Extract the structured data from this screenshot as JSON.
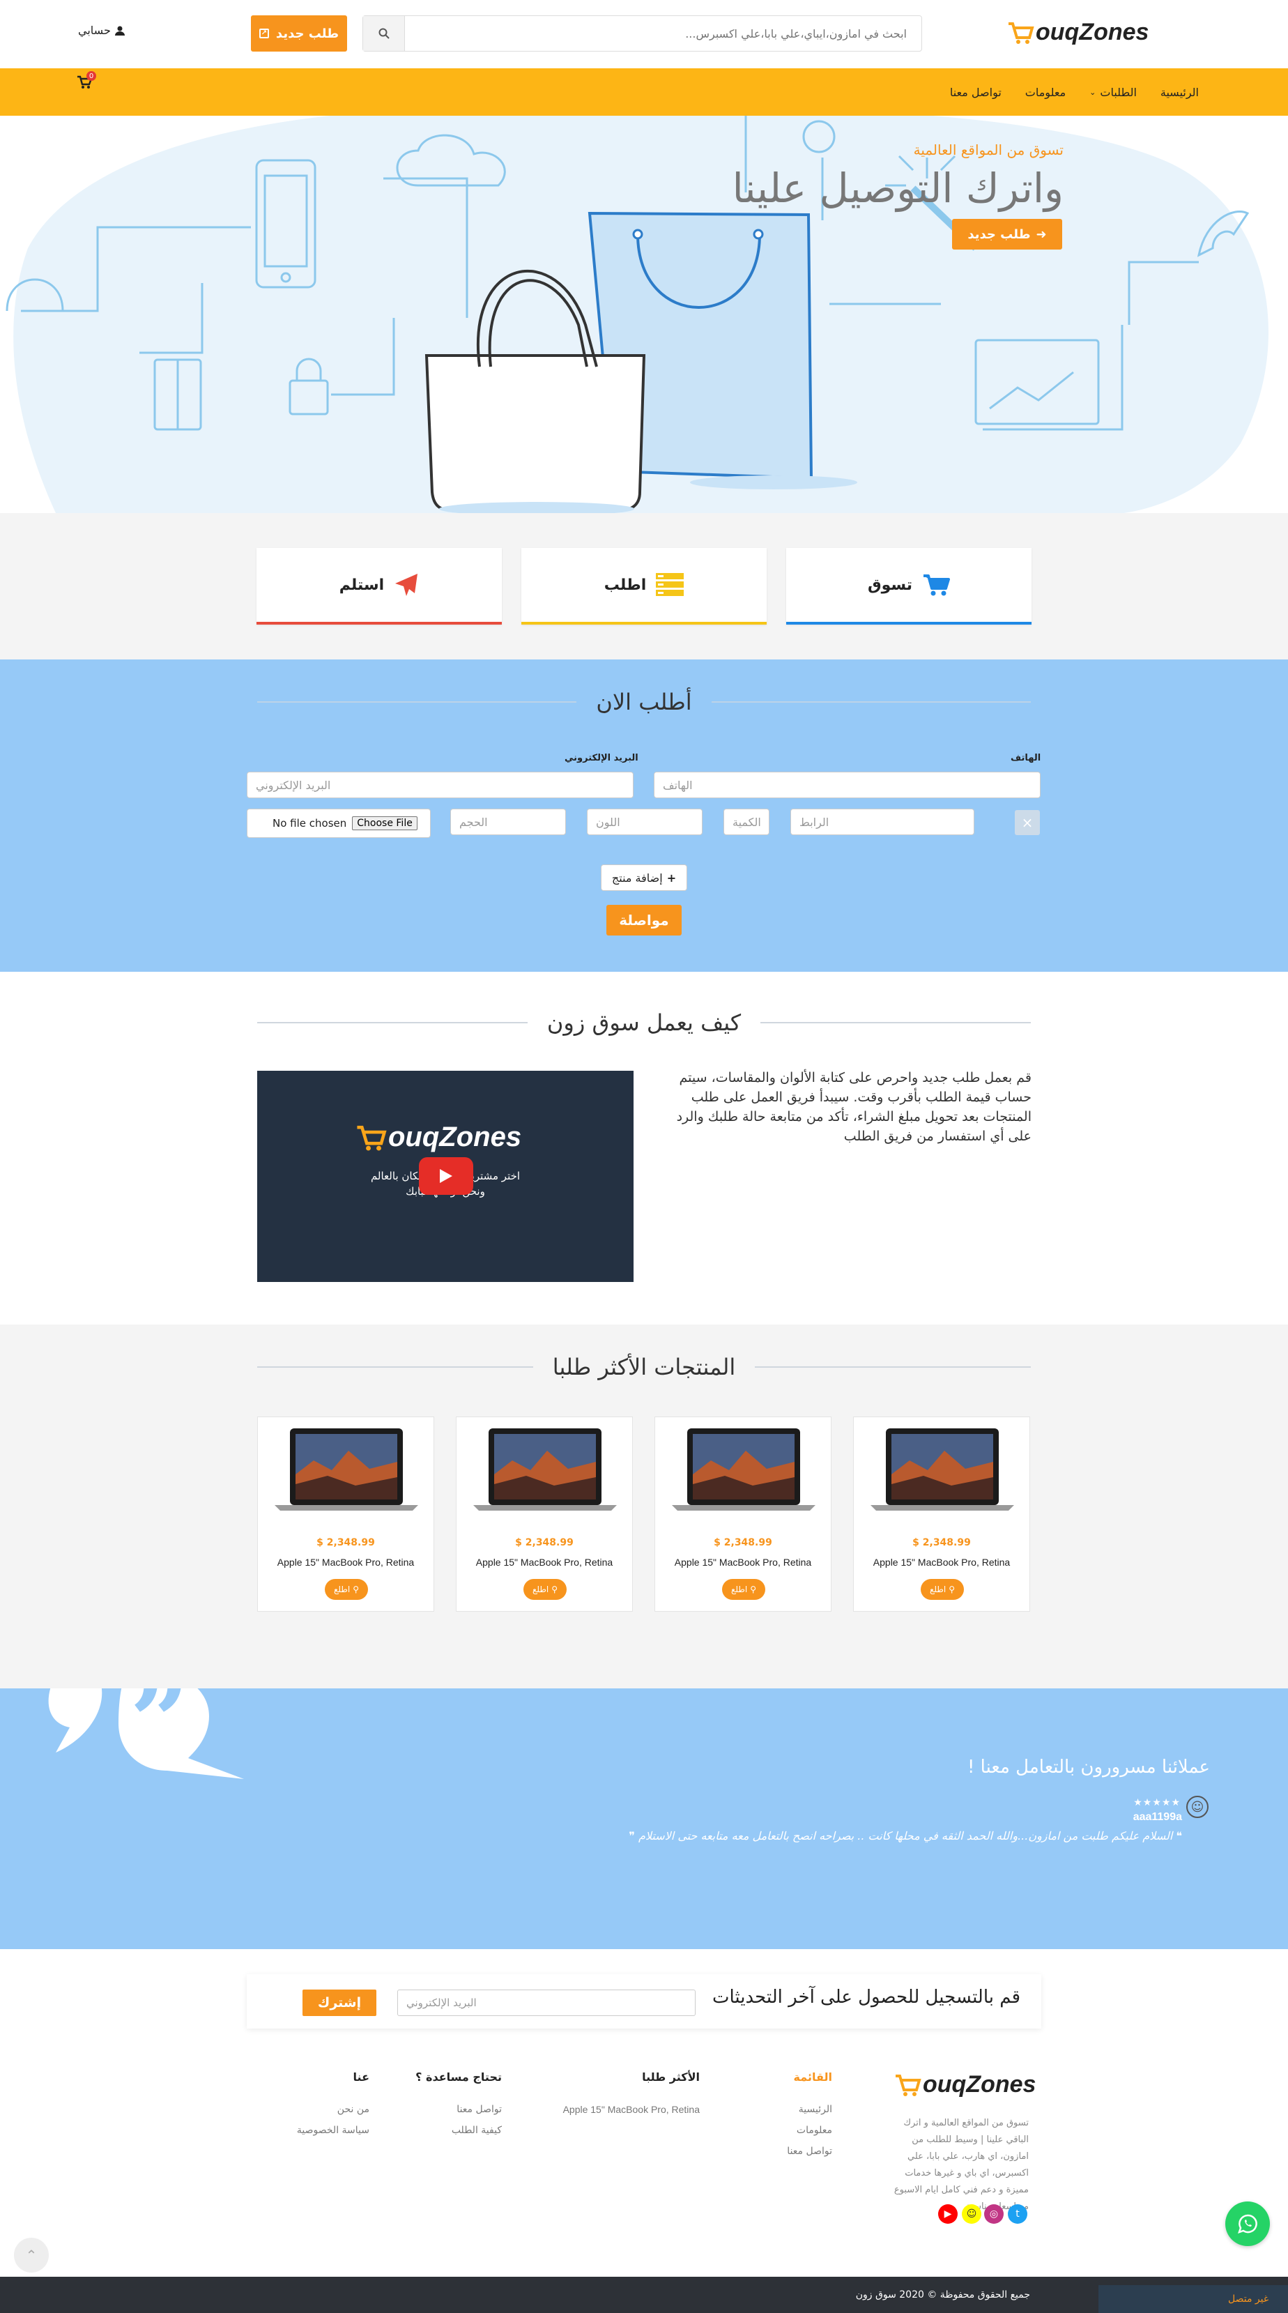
{
  "header": {
    "logo_main": "ouqZones",
    "search_placeholder": "ابحث في امازون،ايباي،علي بابا،علي اكسبرس...",
    "new_order": "طلب جديد",
    "account": "حسابي"
  },
  "nav": {
    "items": [
      "الرئيسية",
      "الطلبات",
      "معلومات",
      "تواصل معنا"
    ],
    "cart_count": "0"
  },
  "hero": {
    "line1": "تسوق من المواقع العالمية",
    "line2": "واترك التوصيل علينا",
    "button": "طلب جديد"
  },
  "steps": {
    "shop": "تسوق",
    "order": "اطلب",
    "receive": "استلم",
    "colors": {
      "shop": "#1e88e5",
      "order": "#f5c518",
      "receive": "#e74c3c"
    }
  },
  "order_form": {
    "title": "أطلب الان",
    "phone_label": "الهاتف",
    "phone_placeholder": "الهاتف",
    "email_label": "البريد الإلكتروني",
    "email_placeholder": "البريد الإلكتروني",
    "link_placeholder": "الرابط",
    "qty_placeholder": "الكمية",
    "color_placeholder": "اللون",
    "size_placeholder": "الحجم",
    "file_button": "Choose File",
    "file_status": "No file chosen",
    "remove": "×",
    "add_product": "إضافة منتج",
    "continue": "مواصلة"
  },
  "how": {
    "title": "كيف يعمل سوق زون",
    "text": "قم بعمل طلب جديد واحرص على كتابة الألوان والمقاسات، سيتم حساب قيمة الطلب بأقرب وقت. سيبدأ فريق العمل على طلب المنتجات بعد تحويل مبلغ الشراء، تأكد من متابعة حالة طلبك والرد على أي استفسار من فريق الطلب",
    "video_logo": "ouqZones",
    "video_line1": "اختر مشتريات من اي مكان بالعالم",
    "video_line2": "ونحن نوصلها لبابك"
  },
  "products": {
    "title": "المنتجات الأكثر طلبا",
    "items": [
      {
        "price": "$ 2,348.99",
        "name": "Apple 15\" MacBook Pro, Retina",
        "button": "اطلع"
      },
      {
        "price": "$ 2,348.99",
        "name": "Apple 15\" MacBook Pro, Retina",
        "button": "اطلع"
      },
      {
        "price": "$ 2,348.99",
        "name": "Apple 15\" MacBook Pro, Retina",
        "button": "اطلع"
      },
      {
        "price": "$ 2,348.99",
        "name": "Apple 15\" MacBook Pro, Retina",
        "button": "اطلع"
      }
    ]
  },
  "testimonials": {
    "title": "عملائنا مسرورون بالتعامل معنا !",
    "stars": "★★★★★",
    "name": "aaa1199a",
    "quote": "السلام عليكم طلبت من امازون...والله الحمد الثقه في محلها كانت .. بصراحه انصح بالتعامل معه متابعه حتى الاستلام"
  },
  "newsletter": {
    "title": "قم بالتسجيل للحصول على آخر التحديثات",
    "placeholder": "البريد الإلكتروني",
    "button": "إشترك"
  },
  "footer": {
    "logo_main": "ouqZones",
    "about": "تسوق من المواقع العالمية و اترك الباقي علينا | وسيط للطلب من امازون، اي هارب، علي بابا، علي اكسبرس، اي باي و غيرها خدمات مميزة و دعم فني كامل ايام الاسبوع مع اسعار مناسبة",
    "menu_title": "القائمة",
    "menu": [
      "الرئيسية",
      "معلومات",
      "تواصل معنا"
    ],
    "popular_title": "الأكثر طلبا",
    "popular": [
      "Apple 15\" MacBook Pro, Retina"
    ],
    "help_title": "تحتاج مساعدة ؟",
    "help": [
      "تواصل معنا",
      "كيفية الطلب"
    ],
    "about_title": "عنا",
    "about_links": [
      "من نحن",
      "سياسة الخصوصية"
    ],
    "copyright": "جميع الحقوق محفوظة © 2020 سوق زون",
    "chat_status": "غير متصل",
    "social_colors": {
      "twitter": "#1da1f2",
      "instagram": "#c13584",
      "snapchat": "#fffc00",
      "youtube": "#ff0000"
    }
  }
}
